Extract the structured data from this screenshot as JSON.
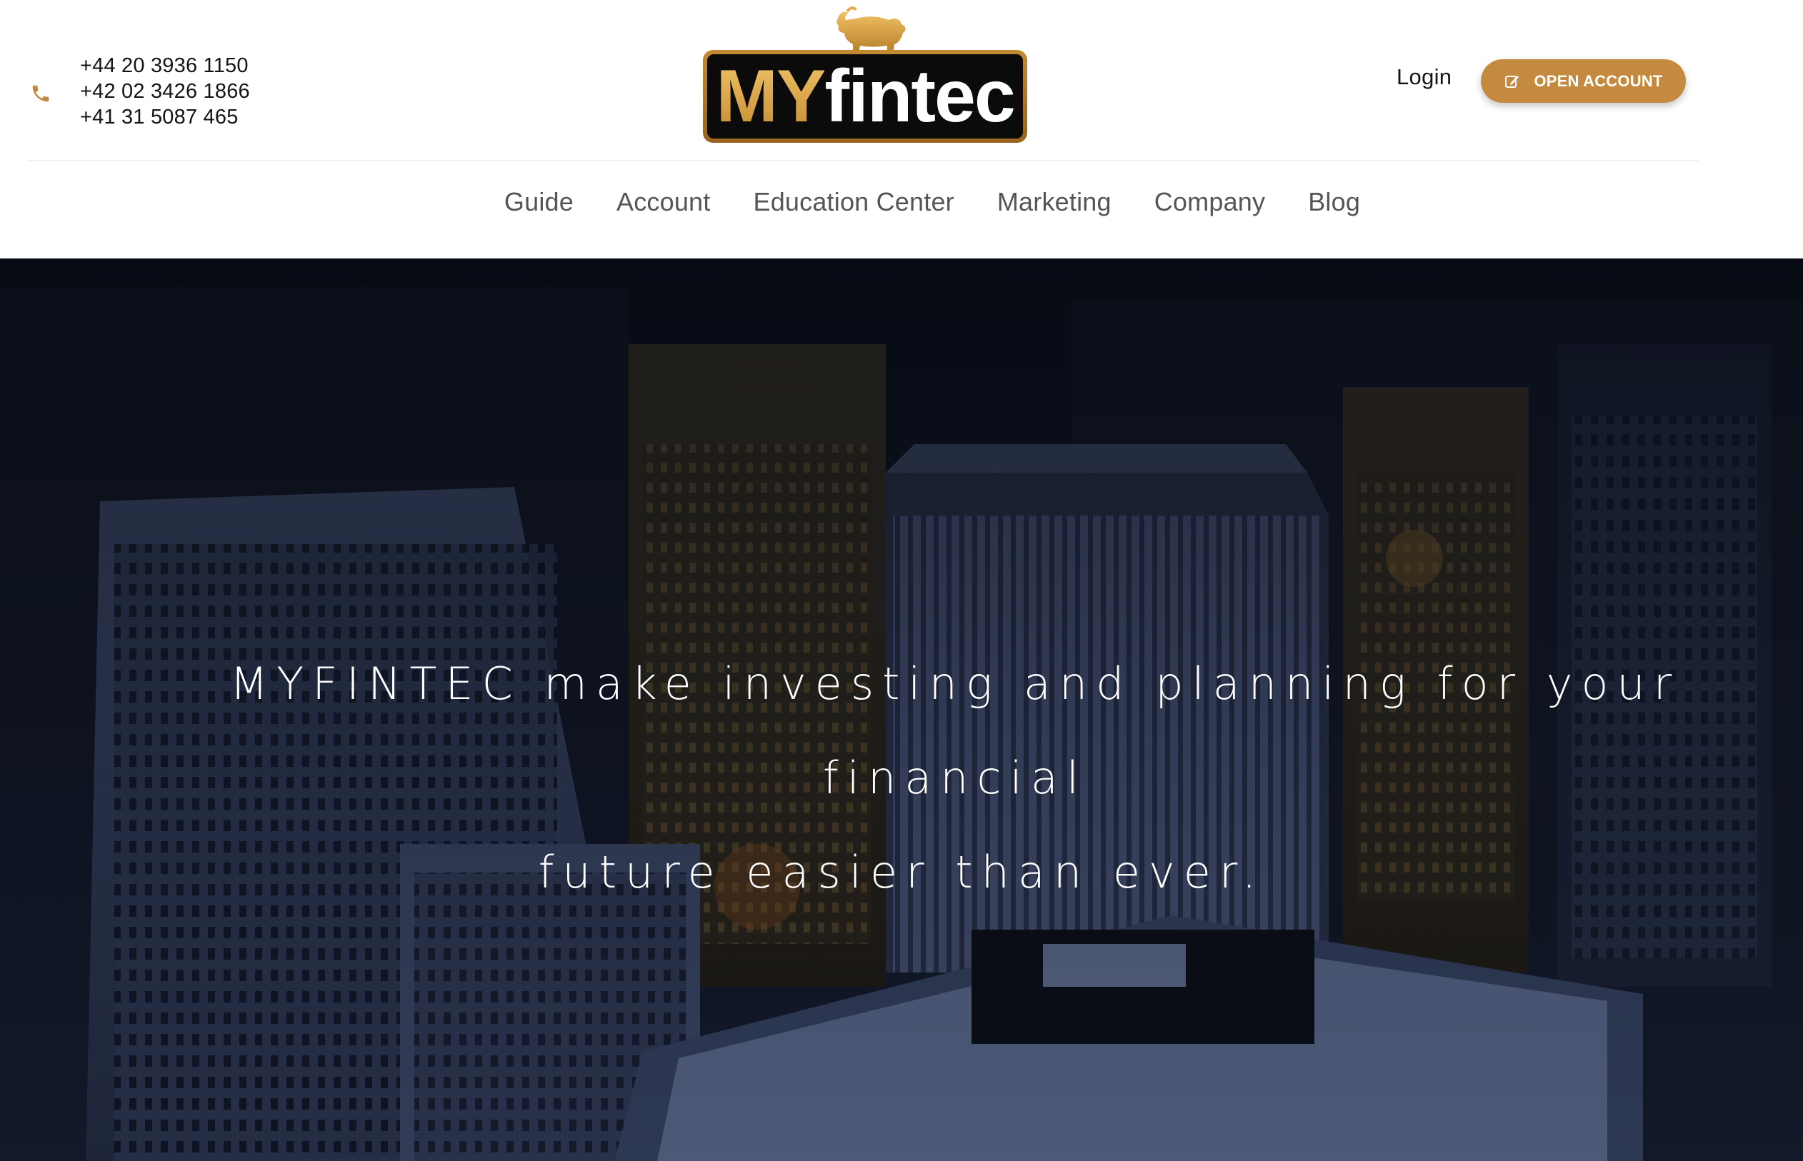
{
  "header": {
    "phones": [
      "+44 20 3936 1150",
      "+42 02 3426 1866",
      "+41 31 5087 465"
    ],
    "phone_icon": "phone-icon",
    "logo": {
      "my": "MY",
      "fintec": "fintec",
      "icon": "bull-icon"
    },
    "login_label": "Login",
    "open_account_label": "OPEN ACCOUNT",
    "open_account_icon": "edit-icon"
  },
  "nav": {
    "items": [
      "Guide",
      "Account",
      "Education Center",
      "Marketing",
      "Company",
      "Blog"
    ]
  },
  "hero": {
    "line1": "MYFINTEC make investing and planning for your financial",
    "line2": "future easier than ever."
  },
  "colors": {
    "accent": "#c48a3f",
    "nav_text": "#555555",
    "hero_bg": "#0c1220"
  }
}
